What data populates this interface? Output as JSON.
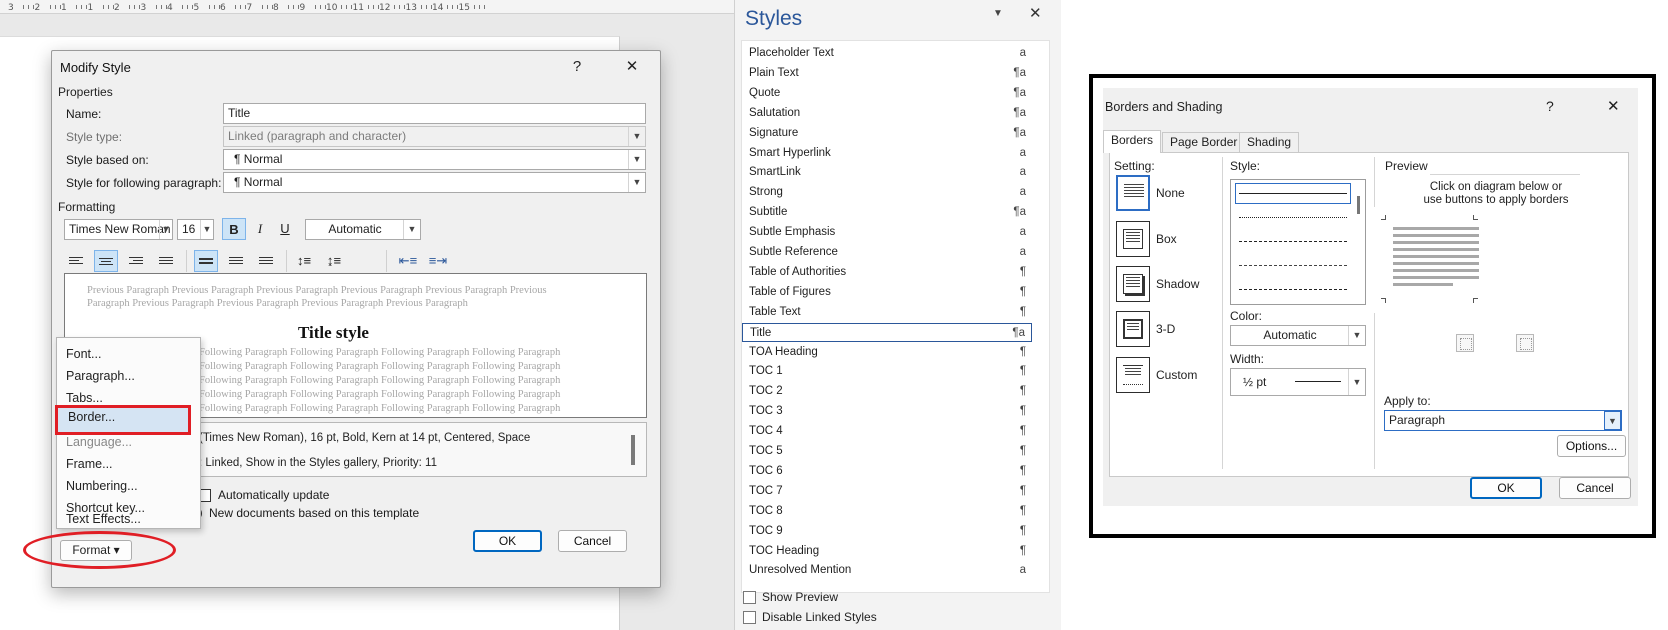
{
  "ruler": {
    "ticks": [
      "3",
      "2",
      "1",
      "1",
      "2",
      "3",
      "4",
      "5",
      "6",
      "7",
      "8",
      "9",
      "10",
      "11",
      "12",
      "13",
      "14",
      "15"
    ]
  },
  "modify_style": {
    "title": "Modify Style",
    "help": "?",
    "close": "✕",
    "properties_label": "Properties",
    "name_label": "Name:",
    "name_value": "Title",
    "style_type_label": "Style type:",
    "style_type_value": "Linked (paragraph and character)",
    "based_on_label": "Style based on:",
    "based_on_value": "¶  Normal",
    "following_label": "Style for following paragraph:",
    "following_value": "¶  Normal",
    "formatting_label": "Formatting",
    "font_value": "Times New Roman",
    "size_value": "16",
    "bold": "B",
    "italic": "I",
    "underline": "U",
    "color_value": "Automatic",
    "preview_previous_1": "Previous Paragraph Previous Paragraph Previous Paragraph Previous Paragraph Previous Paragraph Previous",
    "preview_previous_2": "Paragraph Previous Paragraph Previous Paragraph Previous Paragraph Previous Paragraph",
    "preview_title": "Title style",
    "preview_following": "Following Paragraph Following Paragraph Following Paragraph Following Paragraph",
    "description_1": "(Times New Roman), 16 pt, Bold, Kern at 14 pt, Centered, Space",
    "description_2": ": Linked, Show in the Styles gallery, Priority: 11",
    "auto_update": "Automatically update",
    "new_docs": "New documents based on this template",
    "ok": "OK",
    "cancel": "Cancel",
    "format_button": "Format ▾"
  },
  "format_menu": {
    "items": [
      "Font...",
      "Paragraph...",
      "Tabs...",
      "Border...",
      "Language...",
      "Frame...",
      "Numbering...",
      "Shortcut key...",
      "Text Effects..."
    ],
    "highlighted": "Border..."
  },
  "styles_pane": {
    "title": "Styles",
    "styles": [
      {
        "name": "Placeholder Text",
        "sym": "a"
      },
      {
        "name": "Plain Text",
        "sym": "¶a"
      },
      {
        "name": "Quote",
        "sym": "¶a"
      },
      {
        "name": "Salutation",
        "sym": "¶a"
      },
      {
        "name": "Signature",
        "sym": "¶a"
      },
      {
        "name": "Smart Hyperlink",
        "sym": "a"
      },
      {
        "name": "SmartLink",
        "sym": "a"
      },
      {
        "name": "Strong",
        "sym": "a"
      },
      {
        "name": "Subtitle",
        "sym": "¶a"
      },
      {
        "name": "Subtle Emphasis",
        "sym": "a"
      },
      {
        "name": "Subtle Reference",
        "sym": "a"
      },
      {
        "name": "Table of Authorities",
        "sym": "¶"
      },
      {
        "name": "Table of Figures",
        "sym": "¶"
      },
      {
        "name": "Table Text",
        "sym": "¶"
      },
      {
        "name": "Title",
        "sym": "¶a"
      },
      {
        "name": "TOA Heading",
        "sym": "¶"
      },
      {
        "name": "TOC 1",
        "sym": "¶"
      },
      {
        "name": "TOC 2",
        "sym": "¶"
      },
      {
        "name": "TOC 3",
        "sym": "¶"
      },
      {
        "name": "TOC 4",
        "sym": "¶"
      },
      {
        "name": "TOC 5",
        "sym": "¶"
      },
      {
        "name": "TOC 6",
        "sym": "¶"
      },
      {
        "name": "TOC 7",
        "sym": "¶"
      },
      {
        "name": "TOC 8",
        "sym": "¶"
      },
      {
        "name": "TOC 9",
        "sym": "¶"
      },
      {
        "name": "TOC Heading",
        "sym": "¶"
      },
      {
        "name": "Unresolved Mention",
        "sym": "a"
      }
    ],
    "selected": "Title",
    "show_preview": "Show Preview",
    "disable_linked": "Disable Linked Styles"
  },
  "borders_shading": {
    "title": "Borders and Shading",
    "help": "?",
    "close": "✕",
    "tabs": [
      "Borders",
      "Page Border",
      "Shading"
    ],
    "active_tab": "Borders",
    "setting_label": "Setting:",
    "settings": [
      "None",
      "Box",
      "Shadow",
      "3-D",
      "Custom"
    ],
    "style_label": "Style:",
    "color_label": "Color:",
    "color_value": "Automatic",
    "width_label": "Width:",
    "width_value": "½ pt",
    "preview_label": "Preview",
    "preview_hint_1": "Click on diagram below or",
    "preview_hint_2": "use buttons to apply borders",
    "apply_to_label": "Apply to:",
    "apply_to_value": "Paragraph",
    "options": "Options...",
    "ok": "OK",
    "cancel": "Cancel"
  }
}
